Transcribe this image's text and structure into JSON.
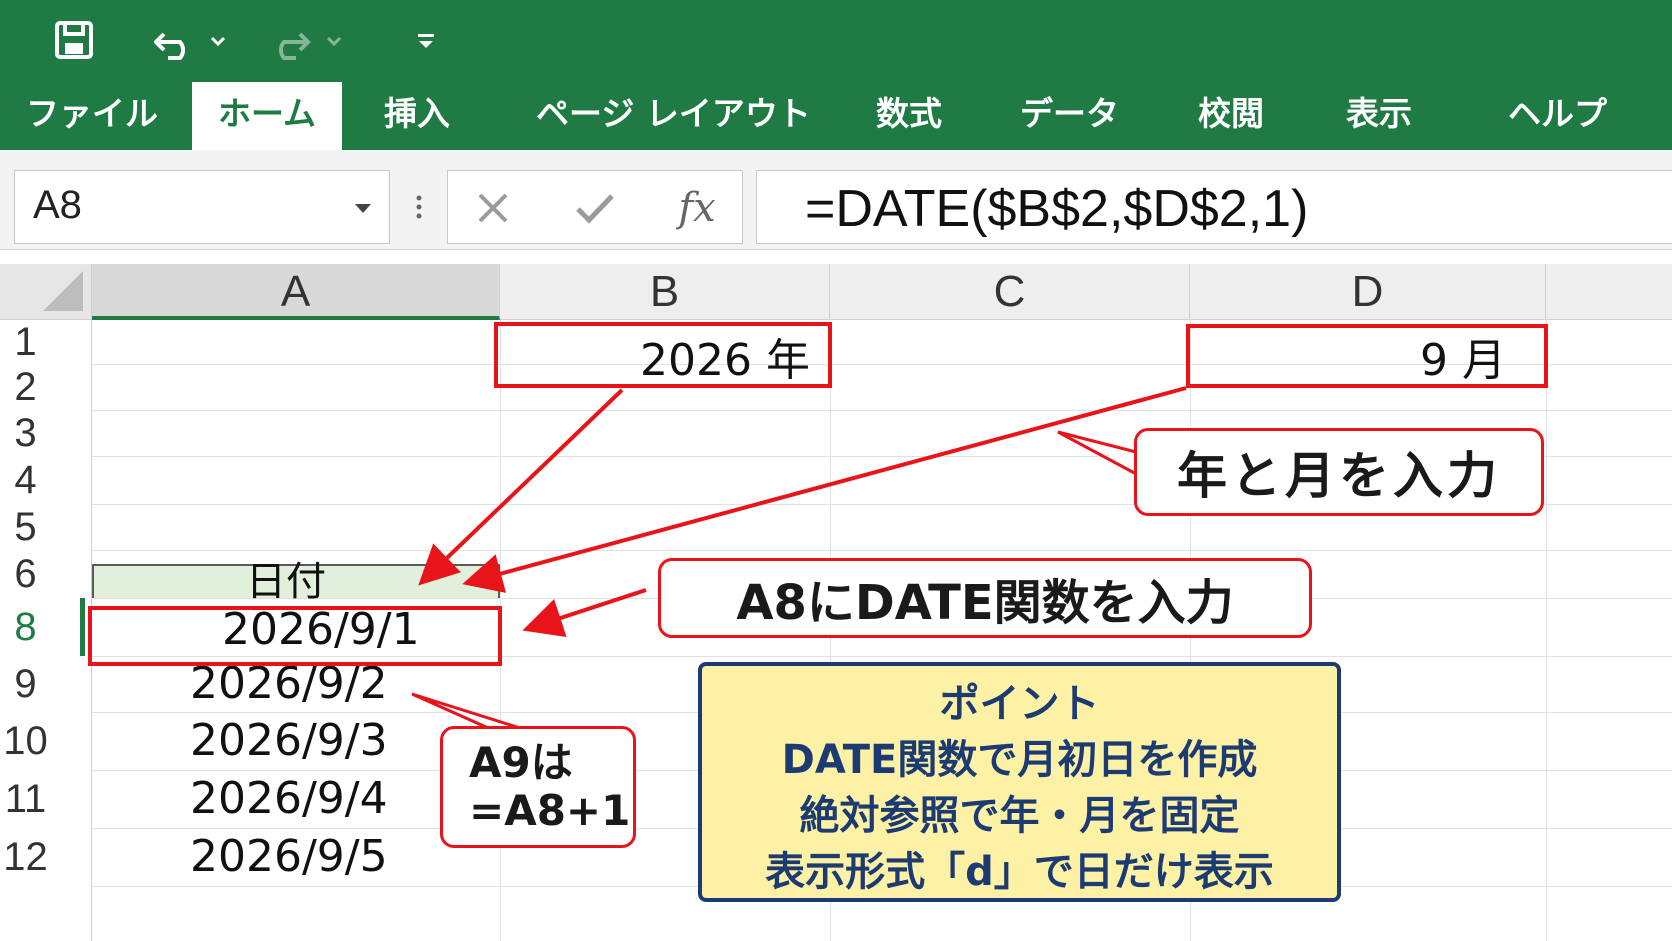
{
  "quick_access": {
    "save_icon": "save-icon",
    "undo_icon": "undo-icon",
    "redo_icon": "redo-icon",
    "customize_icon": "customize-qat-icon"
  },
  "ribbon": {
    "tabs": [
      {
        "label": "ファイル"
      },
      {
        "label": "ホーム",
        "active": true
      },
      {
        "label": "挿入"
      },
      {
        "label": "ページ レイアウト"
      },
      {
        "label": "数式"
      },
      {
        "label": "データ"
      },
      {
        "label": "校閲"
      },
      {
        "label": "表示"
      },
      {
        "label": "ヘルプ"
      }
    ]
  },
  "formula_bar": {
    "name_box": "A8",
    "fx_label": "fx",
    "formula": "=DATE($B$2,$D$2,1)"
  },
  "grid": {
    "columns": [
      "A",
      "B",
      "C",
      "D"
    ],
    "selected_column": "A",
    "rows": [
      "1",
      "2",
      "3",
      "4",
      "5",
      "6",
      "8",
      "9",
      "10",
      "11",
      "12"
    ],
    "selected_row": "8",
    "cells": {
      "B1": "2026 年",
      "D1": "9 月",
      "A6": "日付",
      "A8": "2026/9/1",
      "A9": "2026/9/2",
      "A10": "2026/9/3",
      "A11": "2026/9/4",
      "A12": "2026/9/5"
    }
  },
  "callouts": {
    "input_year_month": "年と月を入力",
    "a8_date": "A8にDATE関数を入力",
    "a9_line1": "A9は",
    "a9_line2": "=A8+1"
  },
  "point": {
    "title": "ポイント",
    "lines": [
      "DATE関数で月初日を作成",
      "絶対参照で年・月を固定",
      "表示形式「d」で日だけ表示"
    ]
  },
  "colors": {
    "excel_green": "#1f7a43",
    "highlight_red": "#e8141a",
    "point_fill": "#fdf1a6",
    "point_border": "#1d3b73"
  }
}
